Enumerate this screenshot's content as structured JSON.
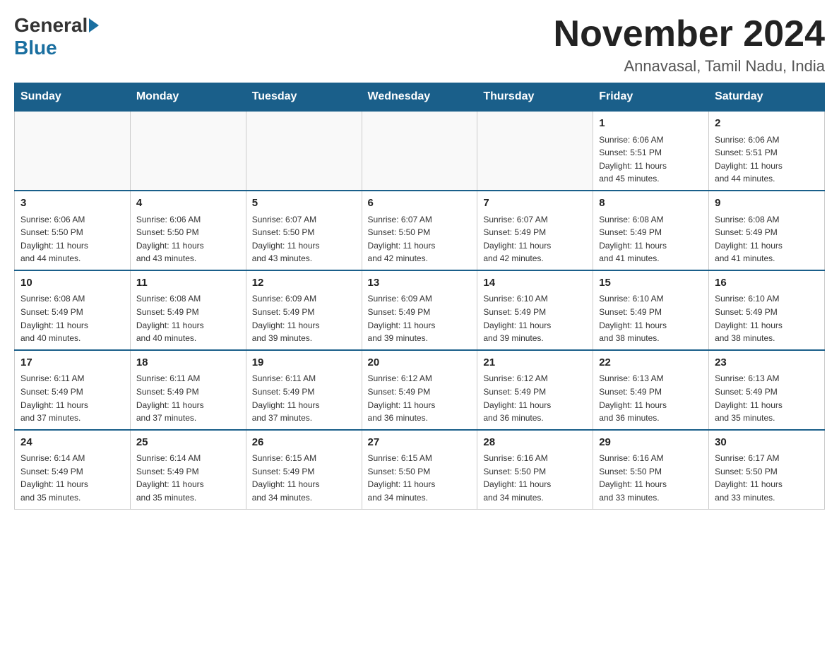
{
  "header": {
    "logo_general": "General",
    "logo_blue": "Blue",
    "month_title": "November 2024",
    "location": "Annavasal, Tamil Nadu, India"
  },
  "calendar": {
    "days_of_week": [
      "Sunday",
      "Monday",
      "Tuesday",
      "Wednesday",
      "Thursday",
      "Friday",
      "Saturday"
    ],
    "weeks": [
      [
        {
          "day": "",
          "info": ""
        },
        {
          "day": "",
          "info": ""
        },
        {
          "day": "",
          "info": ""
        },
        {
          "day": "",
          "info": ""
        },
        {
          "day": "",
          "info": ""
        },
        {
          "day": "1",
          "info": "Sunrise: 6:06 AM\nSunset: 5:51 PM\nDaylight: 11 hours\nand 45 minutes."
        },
        {
          "day": "2",
          "info": "Sunrise: 6:06 AM\nSunset: 5:51 PM\nDaylight: 11 hours\nand 44 minutes."
        }
      ],
      [
        {
          "day": "3",
          "info": "Sunrise: 6:06 AM\nSunset: 5:50 PM\nDaylight: 11 hours\nand 44 minutes."
        },
        {
          "day": "4",
          "info": "Sunrise: 6:06 AM\nSunset: 5:50 PM\nDaylight: 11 hours\nand 43 minutes."
        },
        {
          "day": "5",
          "info": "Sunrise: 6:07 AM\nSunset: 5:50 PM\nDaylight: 11 hours\nand 43 minutes."
        },
        {
          "day": "6",
          "info": "Sunrise: 6:07 AM\nSunset: 5:50 PM\nDaylight: 11 hours\nand 42 minutes."
        },
        {
          "day": "7",
          "info": "Sunrise: 6:07 AM\nSunset: 5:49 PM\nDaylight: 11 hours\nand 42 minutes."
        },
        {
          "day": "8",
          "info": "Sunrise: 6:08 AM\nSunset: 5:49 PM\nDaylight: 11 hours\nand 41 minutes."
        },
        {
          "day": "9",
          "info": "Sunrise: 6:08 AM\nSunset: 5:49 PM\nDaylight: 11 hours\nand 41 minutes."
        }
      ],
      [
        {
          "day": "10",
          "info": "Sunrise: 6:08 AM\nSunset: 5:49 PM\nDaylight: 11 hours\nand 40 minutes."
        },
        {
          "day": "11",
          "info": "Sunrise: 6:08 AM\nSunset: 5:49 PM\nDaylight: 11 hours\nand 40 minutes."
        },
        {
          "day": "12",
          "info": "Sunrise: 6:09 AM\nSunset: 5:49 PM\nDaylight: 11 hours\nand 39 minutes."
        },
        {
          "day": "13",
          "info": "Sunrise: 6:09 AM\nSunset: 5:49 PM\nDaylight: 11 hours\nand 39 minutes."
        },
        {
          "day": "14",
          "info": "Sunrise: 6:10 AM\nSunset: 5:49 PM\nDaylight: 11 hours\nand 39 minutes."
        },
        {
          "day": "15",
          "info": "Sunrise: 6:10 AM\nSunset: 5:49 PM\nDaylight: 11 hours\nand 38 minutes."
        },
        {
          "day": "16",
          "info": "Sunrise: 6:10 AM\nSunset: 5:49 PM\nDaylight: 11 hours\nand 38 minutes."
        }
      ],
      [
        {
          "day": "17",
          "info": "Sunrise: 6:11 AM\nSunset: 5:49 PM\nDaylight: 11 hours\nand 37 minutes."
        },
        {
          "day": "18",
          "info": "Sunrise: 6:11 AM\nSunset: 5:49 PM\nDaylight: 11 hours\nand 37 minutes."
        },
        {
          "day": "19",
          "info": "Sunrise: 6:11 AM\nSunset: 5:49 PM\nDaylight: 11 hours\nand 37 minutes."
        },
        {
          "day": "20",
          "info": "Sunrise: 6:12 AM\nSunset: 5:49 PM\nDaylight: 11 hours\nand 36 minutes."
        },
        {
          "day": "21",
          "info": "Sunrise: 6:12 AM\nSunset: 5:49 PM\nDaylight: 11 hours\nand 36 minutes."
        },
        {
          "day": "22",
          "info": "Sunrise: 6:13 AM\nSunset: 5:49 PM\nDaylight: 11 hours\nand 36 minutes."
        },
        {
          "day": "23",
          "info": "Sunrise: 6:13 AM\nSunset: 5:49 PM\nDaylight: 11 hours\nand 35 minutes."
        }
      ],
      [
        {
          "day": "24",
          "info": "Sunrise: 6:14 AM\nSunset: 5:49 PM\nDaylight: 11 hours\nand 35 minutes."
        },
        {
          "day": "25",
          "info": "Sunrise: 6:14 AM\nSunset: 5:49 PM\nDaylight: 11 hours\nand 35 minutes."
        },
        {
          "day": "26",
          "info": "Sunrise: 6:15 AM\nSunset: 5:49 PM\nDaylight: 11 hours\nand 34 minutes."
        },
        {
          "day": "27",
          "info": "Sunrise: 6:15 AM\nSunset: 5:50 PM\nDaylight: 11 hours\nand 34 minutes."
        },
        {
          "day": "28",
          "info": "Sunrise: 6:16 AM\nSunset: 5:50 PM\nDaylight: 11 hours\nand 34 minutes."
        },
        {
          "day": "29",
          "info": "Sunrise: 6:16 AM\nSunset: 5:50 PM\nDaylight: 11 hours\nand 33 minutes."
        },
        {
          "day": "30",
          "info": "Sunrise: 6:17 AM\nSunset: 5:50 PM\nDaylight: 11 hours\nand 33 minutes."
        }
      ]
    ]
  }
}
